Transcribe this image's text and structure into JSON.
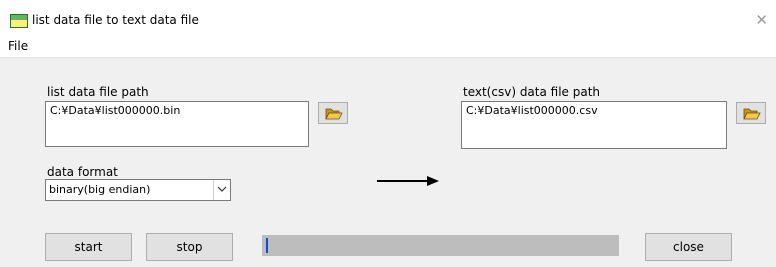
{
  "window": {
    "title": "list data file to text data file",
    "close_glyph": "✕",
    "icon": "app-window-icon"
  },
  "menu": {
    "items": [
      {
        "label": "File"
      }
    ]
  },
  "source": {
    "label": "list data file path",
    "value": "C:¥Data¥list000000.bin",
    "browse_icon": "open-folder-icon"
  },
  "target": {
    "label": "text(csv) data file path",
    "value": "C:¥Data¥list000000.csv",
    "browse_icon": "open-folder-icon"
  },
  "arrow_icon": "right-arrow-icon",
  "format": {
    "label": "data format",
    "selected": "binary(big endian)"
  },
  "buttons": {
    "start": "start",
    "stop": "stop",
    "close": "close"
  },
  "progress": {
    "fraction": 1.0
  },
  "colors": {
    "client_bg": "#f0f0f0",
    "button_bg": "#e1e1e1",
    "progress_fill": "#bdbdbd",
    "progress_caret": "#0b4fd0",
    "folder_icon": "#e8b422"
  }
}
